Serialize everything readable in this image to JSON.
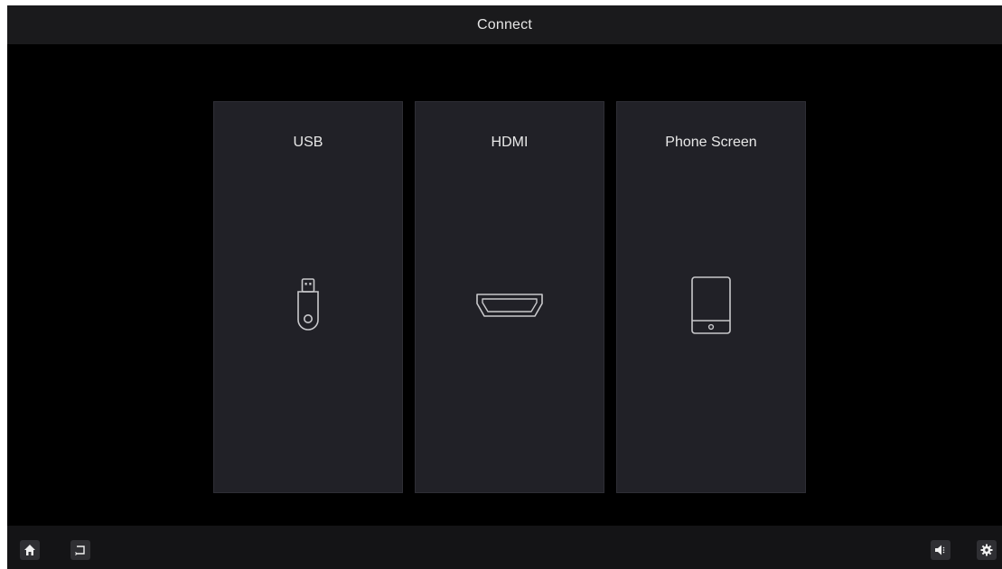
{
  "header": {
    "title": "Connect"
  },
  "sources": [
    {
      "label": "USB",
      "icon": "usb-drive-icon"
    },
    {
      "label": "HDMI",
      "icon": "hdmi-port-icon"
    },
    {
      "label": "Phone Screen",
      "icon": "phone-icon"
    }
  ],
  "bottom_bar": {
    "left": [
      {
        "icon": "home-icon"
      },
      {
        "icon": "back-icon"
      }
    ],
    "right": [
      {
        "icon": "volume-icon"
      },
      {
        "icon": "gear-icon"
      }
    ]
  },
  "colors": {
    "background": "#000000",
    "card": "#212127",
    "bar": "#1a1a1c",
    "text": "#e8e8e8",
    "icon_stroke": "#c9c9cc"
  }
}
